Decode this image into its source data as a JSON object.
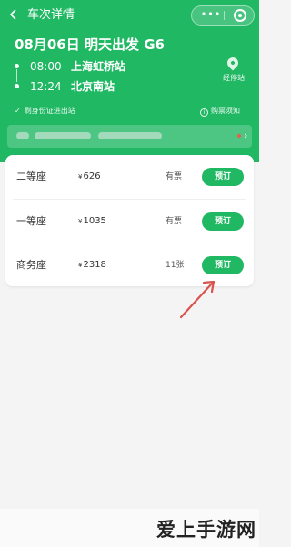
{
  "nav": {
    "title": "车次详情",
    "more_label": "•••"
  },
  "trip": {
    "title": "08月06日 明天出发 G6",
    "depart": {
      "time": "08:00",
      "station": "上海虹桥站"
    },
    "arrive": {
      "time": "12:24",
      "station": "北京南站"
    },
    "stops_label": "经停站",
    "idcard_label": "刷身份证进出站",
    "notice_label": "购票须知"
  },
  "banner": {
    "chevron": "›",
    "blurred": true
  },
  "seats": [
    {
      "name": "二等座",
      "currency": "¥",
      "price": "626",
      "availability": "有票",
      "button": "预订"
    },
    {
      "name": "一等座",
      "currency": "¥",
      "price": "1035",
      "availability": "有票",
      "button": "预订"
    },
    {
      "name": "商务座",
      "currency": "¥",
      "price": "2318",
      "availability": "11张",
      "button": "预订"
    }
  ],
  "watermark": "爱上手游网",
  "colors": {
    "brand_green": "#21b864",
    "arrow_red": "#d9534f",
    "badge_red": "#ee5a4c"
  }
}
